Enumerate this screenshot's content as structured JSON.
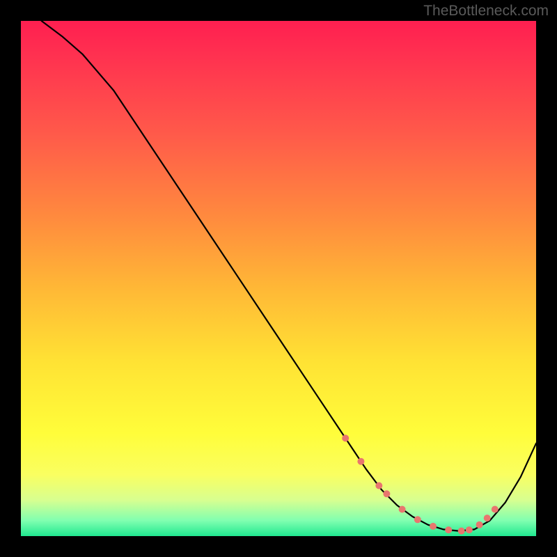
{
  "watermark": "TheBottleneck.com",
  "chart_data": {
    "type": "line",
    "title": "",
    "xlabel": "",
    "ylabel": "",
    "xlim": [
      0,
      100
    ],
    "ylim": [
      0,
      100
    ],
    "series": [
      {
        "name": "curve",
        "x": [
          4,
          8,
          12,
          18,
          25,
          33,
          41,
          49,
          57,
          63,
          67,
          70,
          73,
          76,
          79,
          82,
          85,
          88,
          91,
          94,
          97,
          100
        ],
        "y": [
          100,
          97,
          93.5,
          86.5,
          76,
          64,
          52,
          40,
          28,
          19,
          13,
          9,
          6,
          3.8,
          2.2,
          1.3,
          1,
          1.3,
          3,
          6.5,
          11.5,
          18
        ]
      }
    ],
    "markers": {
      "name": "highlight-dots",
      "x": [
        63,
        66,
        69.5,
        71,
        74,
        77,
        80,
        83,
        85.5,
        87,
        89,
        90.5,
        92
      ],
      "y": [
        19,
        14.5,
        9.8,
        8.2,
        5.2,
        3.2,
        1.9,
        1.2,
        1.0,
        1.2,
        2.2,
        3.5,
        5.2
      ]
    },
    "gradient_stops": [
      {
        "pos": 0.0,
        "color": "#ff1f50"
      },
      {
        "pos": 0.22,
        "color": "#ff5a4a"
      },
      {
        "pos": 0.52,
        "color": "#ffb836"
      },
      {
        "pos": 0.8,
        "color": "#fffd3a"
      },
      {
        "pos": 0.97,
        "color": "#80ffb0"
      },
      {
        "pos": 1.0,
        "color": "#20e890"
      }
    ]
  }
}
